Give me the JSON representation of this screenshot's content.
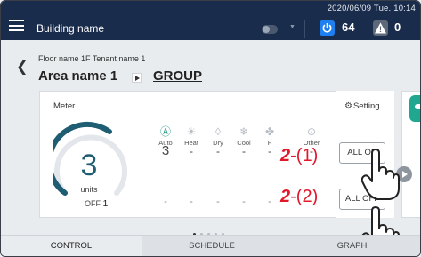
{
  "header": {
    "building_name": "Building name",
    "datetime": "2020/06/09 Tue. 10:14",
    "power_on_count": "64",
    "alarm_count": "0",
    "alarm_symbol": "!"
  },
  "breadcrumb": {
    "floor_tenant": "Floor name 1F Tenant name 1",
    "area_name": "Area name 1",
    "group_link": "GROUP"
  },
  "card": {
    "meter_label": "Meter",
    "units_value": "3",
    "units_label": "units",
    "off_label": "OFF",
    "off_value": "1",
    "modes": [
      {
        "label": "Auto",
        "icon": "auto-icon",
        "count": "3",
        "off": "-"
      },
      {
        "label": "Heat",
        "icon": "sun-icon",
        "count": "-",
        "off": "-"
      },
      {
        "label": "Dry",
        "icon": "droplet-icon",
        "count": "-",
        "off": "-"
      },
      {
        "label": "Cool",
        "icon": "snowflake-icon",
        "count": "-",
        "off": "-"
      },
      {
        "label": "F",
        "icon": "fan-icon",
        "count": "-",
        "off": "-"
      },
      {
        "label": "Other",
        "icon": "other-icon",
        "count": "-",
        "off": "-"
      }
    ],
    "setting_label": "Setting",
    "all_on_label": "ALL ON",
    "all_off_label": "ALL OFF",
    "accent_color": "#1e9680"
  },
  "callouts": {
    "c1_num": "2",
    "c1_tail": "-(1)",
    "c2_num": "2",
    "c2_tail": "-(2)",
    "color": "#e0182a"
  },
  "bottom_nav": {
    "tabs": [
      "CONTROL",
      "SCHEDULE",
      "GRAPH"
    ],
    "active": "CONTROL"
  },
  "pagination": {
    "pages": 5,
    "current": 1
  }
}
